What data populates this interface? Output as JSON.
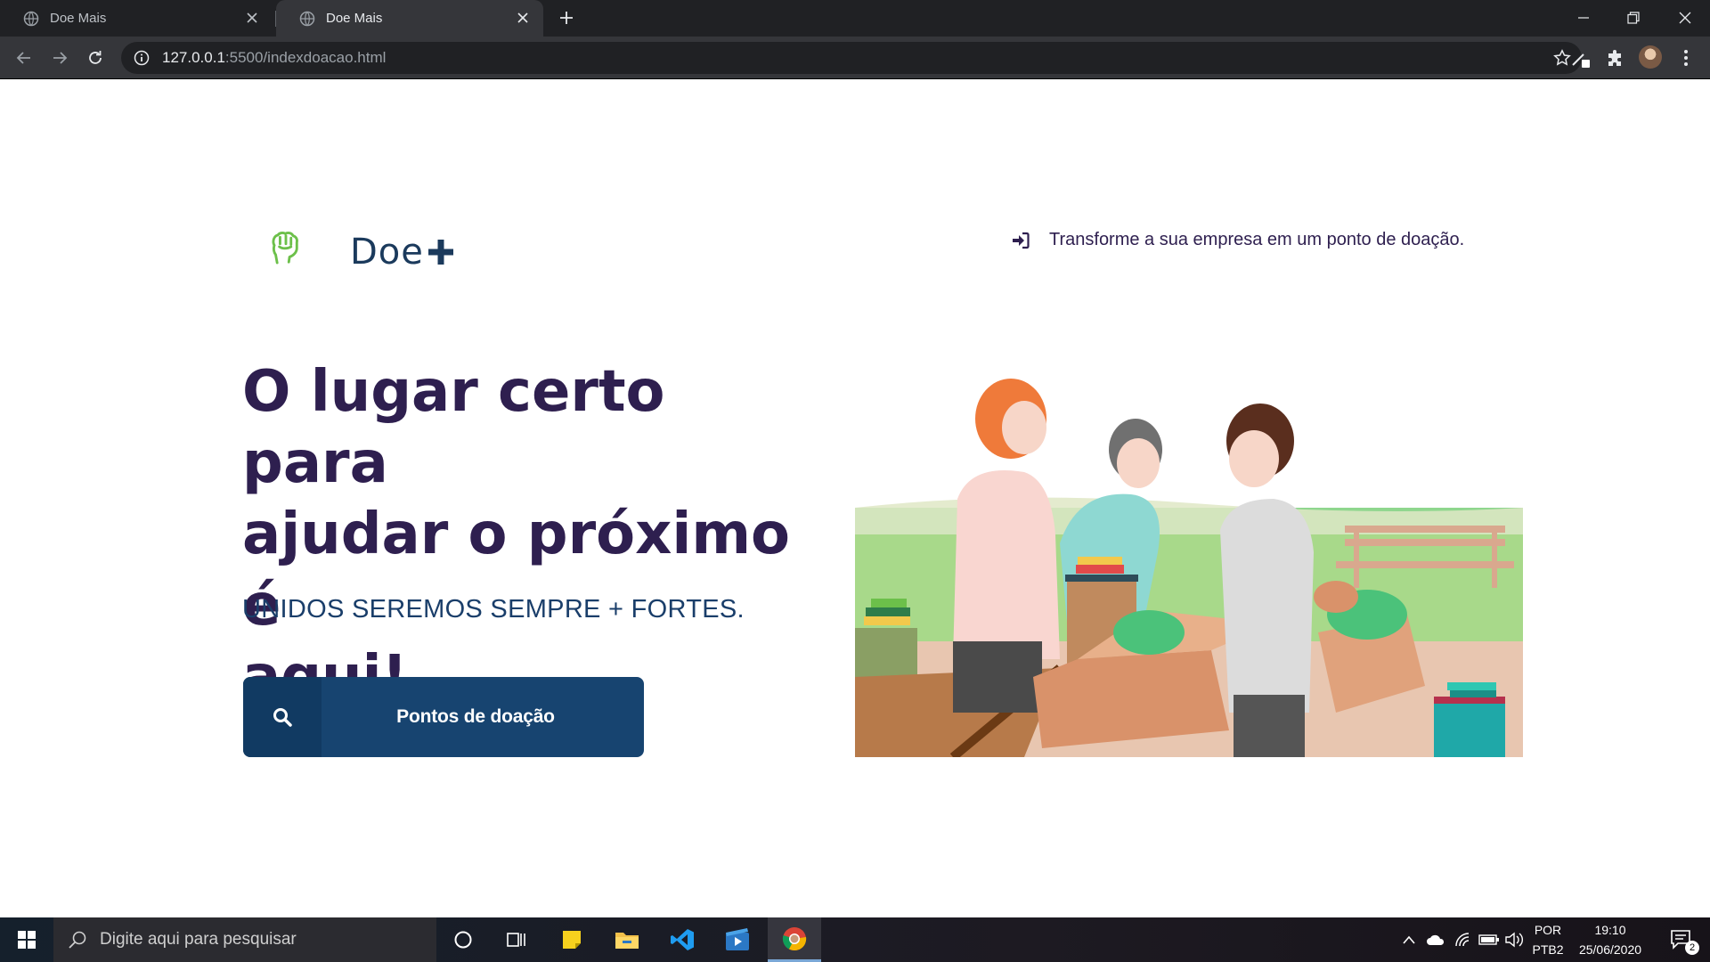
{
  "browser": {
    "tabs": [
      {
        "title": "Doe Mais",
        "active": false
      },
      {
        "title": "Doe Mais",
        "active": true
      }
    ],
    "url_host": "127.0.0.1",
    "url_rest": ":5500/indexdoacao.html"
  },
  "page": {
    "logo_text": "Doe",
    "partner_link": "Transforme a sua empresa em um ponto de doação.",
    "headline_lines": [
      "O lugar certo para",
      "ajudar o próximo é",
      "aqui!"
    ],
    "subtitle": "UNIDOS SEREMOS SEMPRE + FORTES.",
    "cta_label": "Pontos de doação",
    "colors": {
      "headline": "#2e1f4f",
      "subtitle": "#1a3e6a",
      "button": "#174470",
      "logo_green": "#6cc04a"
    }
  },
  "taskbar": {
    "search_placeholder": "Digite aqui para pesquisar",
    "language": "POR",
    "layout": "PTB2",
    "time": "19:10",
    "date": "25/06/2020",
    "notifications": "2",
    "pinned_icons": [
      "cortana-icon",
      "task-view-icon",
      "sticky-notes-icon",
      "file-explorer-icon",
      "vscode-icon",
      "movies-icon",
      "chrome-icon"
    ]
  }
}
